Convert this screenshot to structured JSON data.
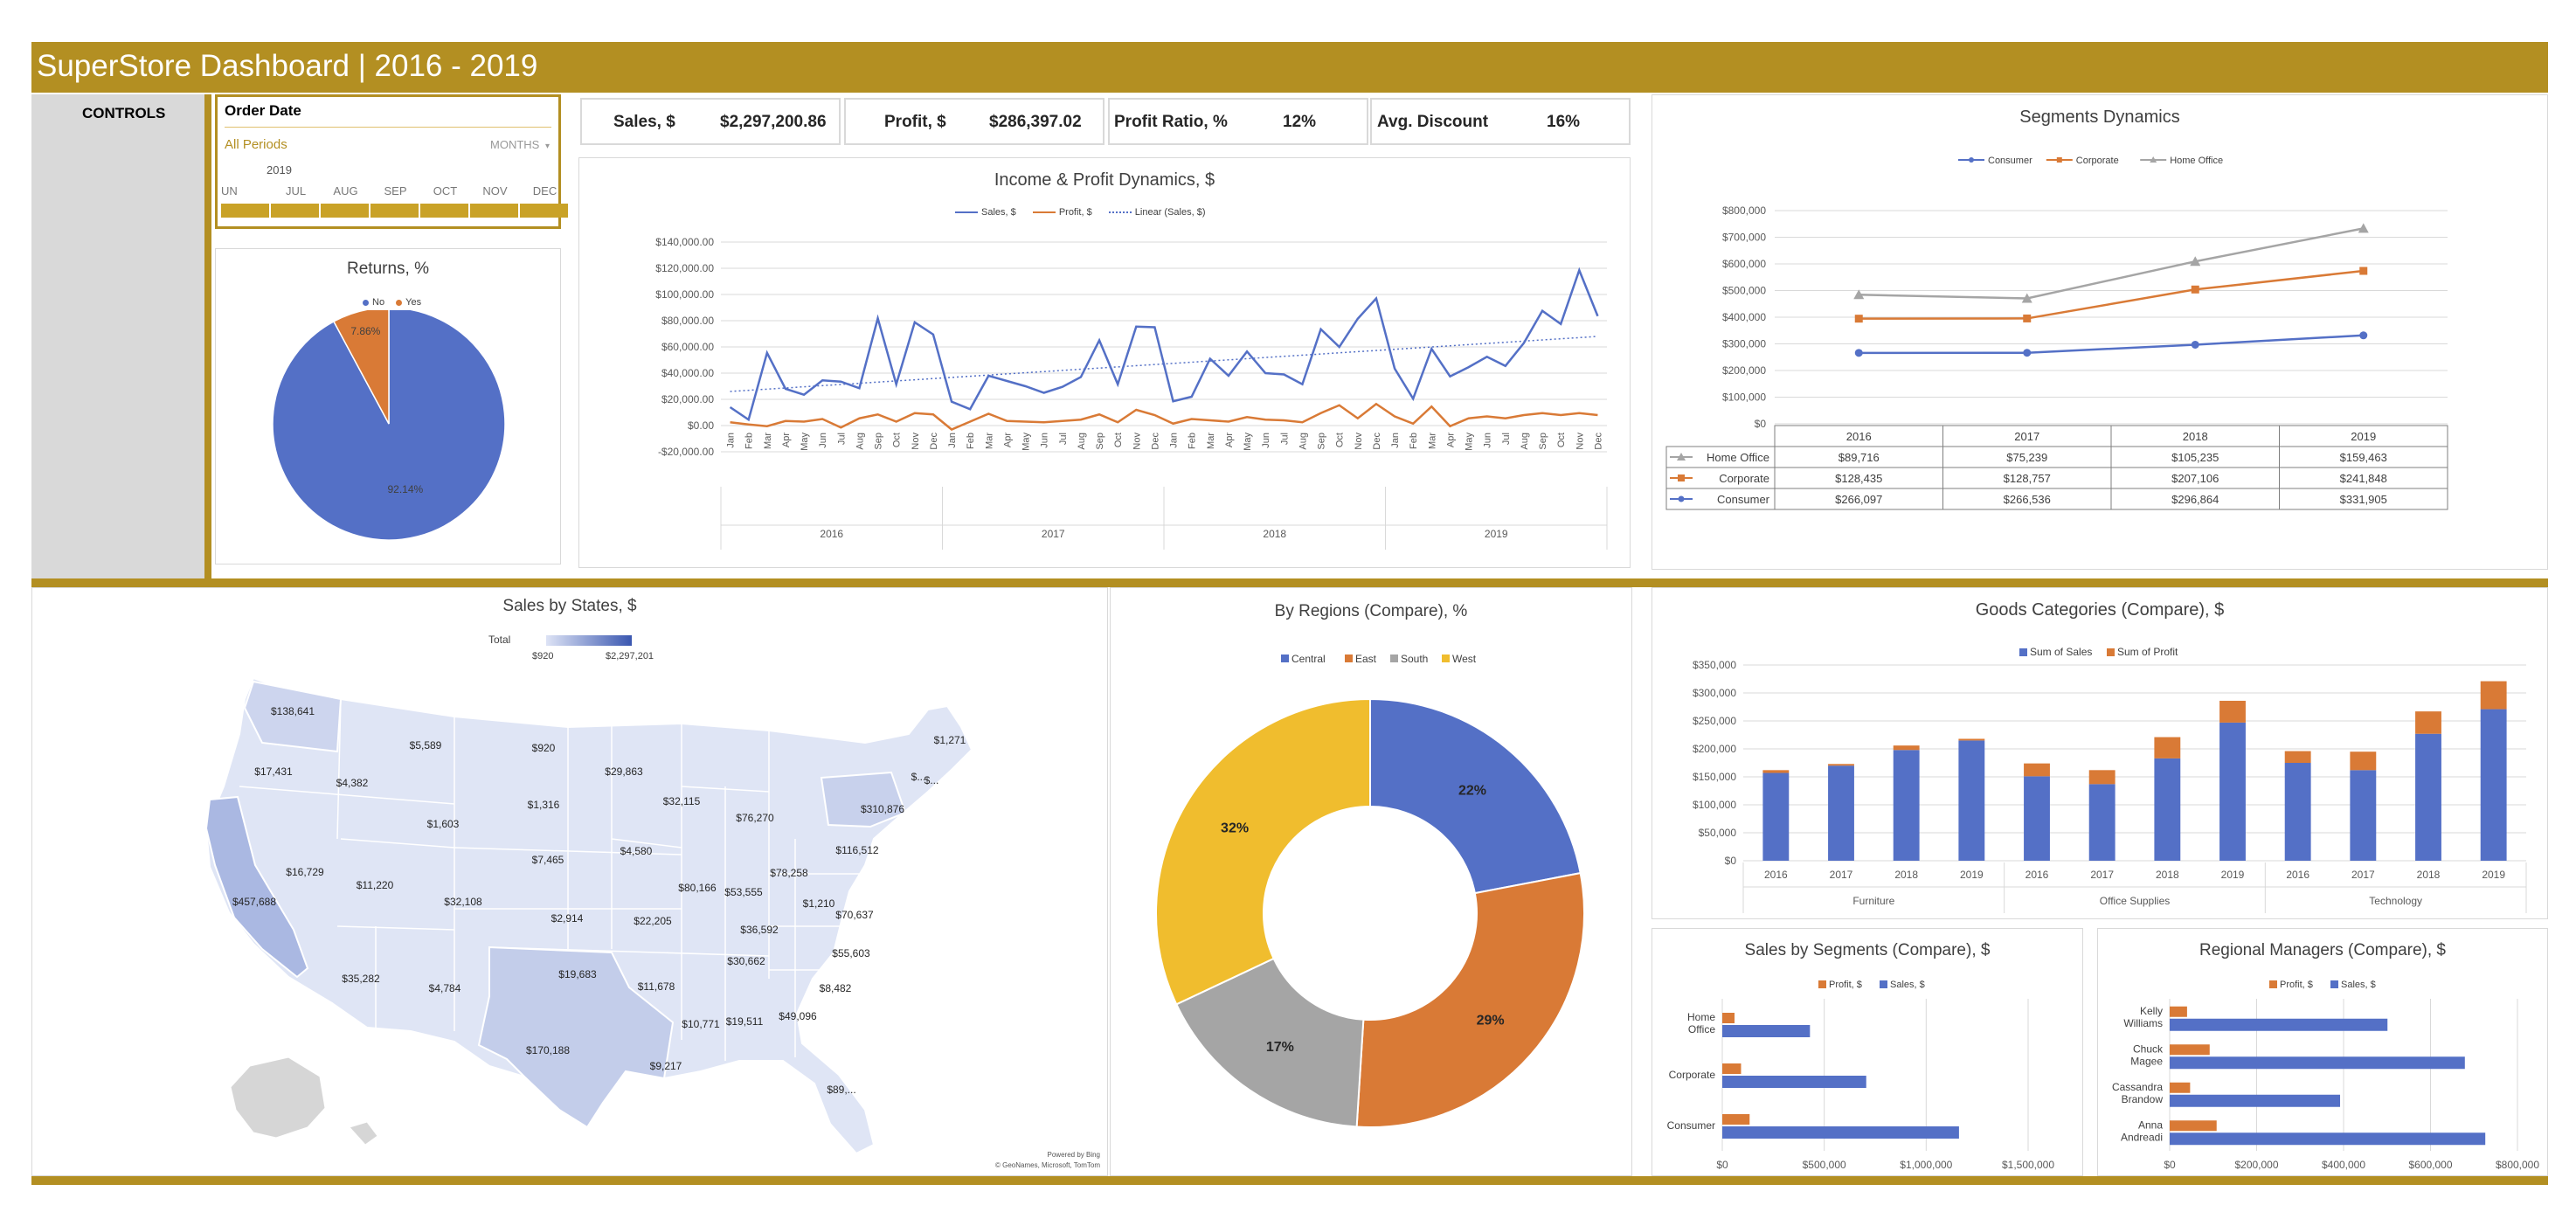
{
  "header": {
    "title": "SuperStore Dashboard | 2016 - 2019"
  },
  "controls": {
    "label": "CONTROLS"
  },
  "timeline": {
    "title": "Order Date",
    "period": "All Periods",
    "unit": "MONTHS",
    "year": "2019",
    "months": [
      "UN",
      "JUL",
      "AUG",
      "SEP",
      "OCT",
      "NOV",
      "DEC"
    ]
  },
  "kpis": [
    {
      "label": "Sales, $",
      "value": "$2,297,200.86"
    },
    {
      "label": "Profit, $",
      "value": "$286,397.02"
    },
    {
      "label": "Profit Ratio, %",
      "value": "12%"
    },
    {
      "label": "Avg. Discount",
      "value": "16%"
    }
  ],
  "colors": {
    "gold": "#b38f22",
    "blue": "#5470c6",
    "orange": "#d97a36",
    "gray": "#a5a5a5",
    "yellow": "#f0bd2e"
  },
  "returns": {
    "title": "Returns, %",
    "legend": [
      "No",
      "Yes"
    ]
  },
  "income": {
    "title": "Income & Profit Dynamics, $",
    "legend": [
      "Sales, $",
      "Profit, $",
      "Linear (Sales, $)"
    ],
    "months": [
      "Jan",
      "Feb",
      "Mar",
      "Apr",
      "May",
      "Jun",
      "Jul",
      "Aug",
      "Sep",
      "Oct",
      "Nov",
      "Dec"
    ],
    "years": [
      "2016",
      "2017",
      "2018",
      "2019"
    ]
  },
  "segdyn": {
    "title": "Segments Dynamics",
    "legend": [
      "Consumer",
      "Corporate",
      "Home Office"
    ]
  },
  "map": {
    "title": "Sales by States, $",
    "legend_label": "Total",
    "legend_min": "$920",
    "legend_max": "$2,297,201",
    "credit1": "Powered by Bing",
    "credit2": "© GeoNames, Microsoft, TomTom",
    "labels": [
      {
        "t": "$138,641",
        "x": 335,
        "y": 818
      },
      {
        "t": "$17,431",
        "x": 313,
        "y": 887
      },
      {
        "t": "$5,589",
        "x": 487,
        "y": 857
      },
      {
        "t": "$4,382",
        "x": 403,
        "y": 900
      },
      {
        "t": "$920",
        "x": 622,
        "y": 860
      },
      {
        "t": "$29,863",
        "x": 714,
        "y": 887
      },
      {
        "t": "$1,271",
        "x": 1087,
        "y": 851
      },
      {
        "t": "$...",
        "x": 1051,
        "y": 893
      },
      {
        "t": "$...",
        "x": 1066,
        "y": 897
      },
      {
        "t": "$1,603",
        "x": 507,
        "y": 947
      },
      {
        "t": "$1,316",
        "x": 622,
        "y": 925
      },
      {
        "t": "$32,115",
        "x": 780,
        "y": 921
      },
      {
        "t": "$76,270",
        "x": 864,
        "y": 940
      },
      {
        "t": "$310,876",
        "x": 1010,
        "y": 930
      },
      {
        "t": "$7,465",
        "x": 627,
        "y": 988
      },
      {
        "t": "$4,580",
        "x": 728,
        "y": 978
      },
      {
        "t": "$116,512",
        "x": 981,
        "y": 977
      },
      {
        "t": "$16,729",
        "x": 349,
        "y": 1002
      },
      {
        "t": "$11,220",
        "x": 429,
        "y": 1017
      },
      {
        "t": "$78,258",
        "x": 903,
        "y": 1003
      },
      {
        "t": "$80,166",
        "x": 798,
        "y": 1020
      },
      {
        "t": "$53,555",
        "x": 851,
        "y": 1025
      },
      {
        "t": "$1,210",
        "x": 937,
        "y": 1038
      },
      {
        "t": "$457,688",
        "x": 291,
        "y": 1036
      },
      {
        "t": "$32,108",
        "x": 530,
        "y": 1036
      },
      {
        "t": "$70,637",
        "x": 978,
        "y": 1051
      },
      {
        "t": "$2,914",
        "x": 649,
        "y": 1055
      },
      {
        "t": "$22,205",
        "x": 747,
        "y": 1058
      },
      {
        "t": "$36,592",
        "x": 869,
        "y": 1068
      },
      {
        "t": "$55,603",
        "x": 974,
        "y": 1095
      },
      {
        "t": "$19,683",
        "x": 661,
        "y": 1119
      },
      {
        "t": "$30,662",
        "x": 854,
        "y": 1104
      },
      {
        "t": "$35,282",
        "x": 413,
        "y": 1124
      },
      {
        "t": "$4,784",
        "x": 509,
        "y": 1135
      },
      {
        "t": "$11,678",
        "x": 751,
        "y": 1133
      },
      {
        "t": "$8,482",
        "x": 956,
        "y": 1135
      },
      {
        "t": "$49,096",
        "x": 913,
        "y": 1167
      },
      {
        "t": "$19,511",
        "x": 852,
        "y": 1173
      },
      {
        "t": "$10,771",
        "x": 802,
        "y": 1176
      },
      {
        "t": "$170,188",
        "x": 627,
        "y": 1206
      },
      {
        "t": "$9,217",
        "x": 762,
        "y": 1224
      },
      {
        "t": "$89,...",
        "x": 963,
        "y": 1251
      }
    ]
  },
  "regions": {
    "title": "By Regions (Compare), %"
  },
  "goods": {
    "title": "Goods Categories (Compare), $",
    "legend": [
      "Sum of Sales",
      "Sum of Profit"
    ]
  },
  "segments": {
    "title": "Sales by Segments (Compare), $",
    "legend": [
      "Profit, $",
      "Sales, $"
    ]
  },
  "managers": {
    "title": "Regional Managers (Compare), $",
    "legend": [
      "Profit, $",
      "Sales, $"
    ]
  },
  "chart_data": [
    {
      "id": "returns",
      "type": "pie",
      "title": "Returns, %",
      "categories": [
        "No",
        "Yes"
      ],
      "values": [
        92.14,
        7.86
      ],
      "labels": [
        "92.14%",
        "7.86%"
      ],
      "legend_position": "top"
    },
    {
      "id": "income",
      "type": "line",
      "title": "Income & Profit Dynamics, $",
      "x": [
        "Jan 2016",
        "Feb 2016",
        "Mar 2016",
        "Apr 2016",
        "May 2016",
        "Jun 2016",
        "Jul 2016",
        "Aug 2016",
        "Sep 2016",
        "Oct 2016",
        "Nov 2016",
        "Dec 2016",
        "Jan 2017",
        "Feb 2017",
        "Mar 2017",
        "Apr 2017",
        "May 2017",
        "Jun 2017",
        "Jul 2017",
        "Aug 2017",
        "Sep 2017",
        "Oct 2017",
        "Nov 2017",
        "Dec 2017",
        "Jan 2018",
        "Feb 2018",
        "Mar 2018",
        "Apr 2018",
        "May 2018",
        "Jun 2018",
        "Jul 2018",
        "Aug 2018",
        "Sep 2018",
        "Oct 2018",
        "Nov 2018",
        "Dec 2018",
        "Jan 2019",
        "Feb 2019",
        "Mar 2019",
        "Apr 2019",
        "May 2019",
        "Jun 2019",
        "Jul 2019",
        "Aug 2019",
        "Sep 2019",
        "Oct 2019",
        "Nov 2019",
        "Dec 2019"
      ],
      "series": [
        {
          "name": "Sales, $",
          "values": [
            14000,
            4500,
            55500,
            28000,
            23500,
            34500,
            33500,
            28500,
            81800,
            31500,
            78800,
            69500,
            18200,
            12500,
            38000,
            34000,
            30000,
            25000,
            29500,
            37000,
            65000,
            31500,
            75500,
            75000,
            18500,
            22000,
            51000,
            38000,
            56500,
            40000,
            39000,
            31500,
            73500,
            60000,
            81500,
            97000,
            43500,
            20500,
            58500,
            37500,
            44500,
            52500,
            45500,
            63000,
            87500,
            77500,
            118500,
            83500
          ]
        },
        {
          "name": "Profit, $",
          "values": [
            2500,
            800,
            -500,
            3500,
            3000,
            5000,
            -1500,
            5500,
            8500,
            3000,
            9500,
            8500,
            -3000,
            3000,
            9000,
            3500,
            3000,
            2500,
            3500,
            4500,
            8500,
            2500,
            12000,
            8000,
            1500,
            5000,
            4000,
            3000,
            6500,
            4500,
            4000,
            2500,
            9500,
            15500,
            5500,
            16500,
            7000,
            1500,
            14500,
            -500,
            5500,
            7000,
            5500,
            8000,
            9500,
            8000,
            9500,
            8000
          ]
        },
        {
          "name": "Linear (Sales, $)",
          "values": [
            26000,
            68000
          ]
        }
      ],
      "ylim": [
        -20000,
        140000
      ],
      "yticks": [
        "-$20,000.00",
        "$0.00",
        "$20,000.00",
        "$40,000.00",
        "$60,000.00",
        "$80,000.00",
        "$100,000.00",
        "$120,000.00",
        "$140,000.00"
      ]
    },
    {
      "id": "segdyn",
      "type": "line",
      "title": "Segments Dynamics",
      "categories": [
        "2016",
        "2017",
        "2018",
        "2019"
      ],
      "series": [
        {
          "name": "Consumer",
          "values": [
            266097,
            266536,
            296864,
            331905
          ],
          "labels": [
            "$266,097",
            "$266,536",
            "$296,864",
            "$331,905"
          ]
        },
        {
          "name": "Corporate",
          "values": [
            128435,
            128757,
            207106,
            241848
          ],
          "labels": [
            "$128,435",
            "$128,757",
            "$207,106",
            "$241,848"
          ]
        },
        {
          "name": "Home Office",
          "values": [
            89716,
            75239,
            105235,
            159463
          ],
          "labels": [
            "$89,716",
            "$75,239",
            "$105,235",
            "$159,463"
          ]
        }
      ],
      "stacked": true,
      "table_rows": [
        "Home Office",
        "Corporate",
        "Consumer"
      ],
      "ylim": [
        0,
        800000
      ],
      "yticks": [
        "$0",
        "$100,000",
        "$200,000",
        "$300,000",
        "$400,000",
        "$500,000",
        "$600,000",
        "$700,000",
        "$800,000"
      ]
    },
    {
      "id": "regions",
      "type": "pie",
      "title": "By Regions (Compare), %",
      "categories": [
        "Central",
        "East",
        "South",
        "West"
      ],
      "values": [
        22,
        29,
        17,
        32
      ],
      "labels": [
        "22%",
        "29%",
        "17%",
        "32%"
      ],
      "donut": true
    },
    {
      "id": "goods",
      "type": "bar",
      "title": "Goods Categories (Compare), $",
      "groups": [
        "Furniture",
        "Office Supplies",
        "Technology"
      ],
      "categories": [
        "2016",
        "2017",
        "2018",
        "2019",
        "2016",
        "2017",
        "2018",
        "2019",
        "2016",
        "2017",
        "2018",
        "2019"
      ],
      "series": [
        {
          "name": "Sum of Sales",
          "values": [
            157000,
            170000,
            198000,
            215000,
            151000,
            137000,
            183000,
            247000,
            175000,
            162000,
            227000,
            271000
          ]
        },
        {
          "name": "Sum of Profit",
          "values": [
            5000,
            3000,
            8000,
            3000,
            23000,
            25000,
            38000,
            39000,
            21000,
            33000,
            40000,
            50000
          ]
        }
      ],
      "stacked": true,
      "ylim": [
        0,
        350000
      ],
      "yticks": [
        "$0",
        "$50,000",
        "$100,000",
        "$150,000",
        "$200,000",
        "$250,000",
        "$300,000",
        "$350,000"
      ]
    },
    {
      "id": "segments",
      "type": "bar",
      "orientation": "horizontal",
      "title": "Sales by Segments (Compare), $",
      "categories": [
        "Home Office",
        "Corporate",
        "Consumer"
      ],
      "series": [
        {
          "name": "Profit, $",
          "values": [
            60000,
            92000,
            134000
          ]
        },
        {
          "name": "Sales, $",
          "values": [
            430000,
            706000,
            1161000
          ]
        }
      ],
      "xlim": [
        0,
        1500000
      ],
      "xticks": [
        "$0",
        "$500,000",
        "$1,000,000",
        "$1,500,000"
      ]
    },
    {
      "id": "managers",
      "type": "bar",
      "orientation": "horizontal",
      "title": "Regional Managers (Compare), $",
      "categories": [
        "Kelly Williams",
        "Chuck Magee",
        "Cassandra Brandow",
        "Anna Andreadi"
      ],
      "series": [
        {
          "name": "Profit, $",
          "values": [
            40000,
            92000,
            47000,
            108000
          ]
        },
        {
          "name": "Sales, $",
          "values": [
            501000,
            679000,
            392000,
            726000
          ]
        }
      ],
      "xlim": [
        0,
        800000
      ],
      "xticks": [
        "$0",
        "$200,000",
        "$400,000",
        "$600,000",
        "$800,000"
      ]
    }
  ]
}
